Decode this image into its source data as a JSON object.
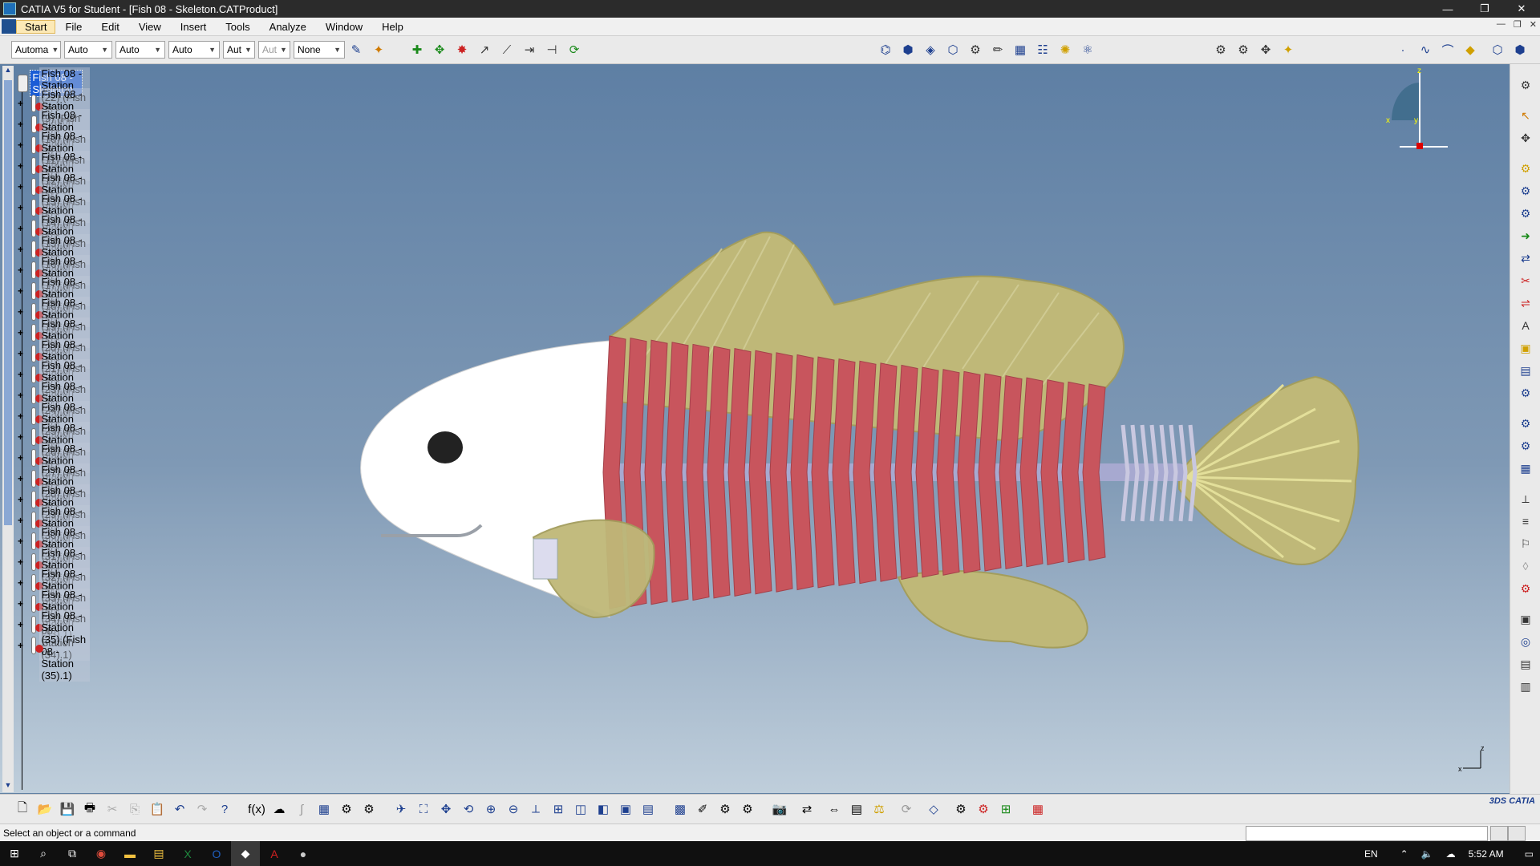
{
  "window": {
    "title": "CATIA V5 for Student - [Fish 08 - Skeleton.CATProduct]",
    "buttons": [
      "—",
      "❐",
      "✕"
    ]
  },
  "menubar": {
    "items": [
      "Start",
      "File",
      "Edit",
      "View",
      "Insert",
      "Tools",
      "Analyze",
      "Window",
      "Help"
    ],
    "doc_buttons": [
      "—",
      "❐",
      "✕"
    ]
  },
  "toolbar_top": {
    "combos": [
      "Automa",
      "Auto",
      "Auto",
      "Auto",
      "Aut",
      "Aut",
      "None"
    ]
  },
  "tree": {
    "root_label": "Fish 08 - Skeleton",
    "rows": [
      "Fish 08 - Station (22) (Fish 08 - Station (22).1)",
      "Fish 08 - Station (9) (Fish 08 - Station (9).1)",
      "Fish 08 - Station (10) (Fish 08 - Station (10).1)",
      "Fish 08 - Station (11) (Fish 08 - Station (11).1)",
      "Fish 08 - Station (12) (Fish 08 - Station (12).1)",
      "Fish 08 - Station (13) (Fish 08 - Station (13).1)",
      "Fish 08 - Station (14) (Fish 08 - Station (14).1)",
      "Fish 08 - Station (15) (Fish 08 - Station (15).1)",
      "Fish 08 - Station (16) (Fish 08 - Station (16).1)",
      "Fish 08 - Station (17) (Fish 08 - Station (17).1)",
      "Fish 08 - Station (18) (Fish 08 - Station (18).1)",
      "Fish 08 - Station (19) (Fish 08 - Station (19).1)",
      "Fish 08 - Station (20) (Fish 08 - Station (20).1)",
      "Fish 08 - Station (21) (Fish 08 - Station (21).1)",
      "Fish 08 - Station (23) (Fish 08 - Station (23).1)",
      "Fish 08 - Station (24) (Fish 08 - Station (24).1)",
      "Fish 08 - Station (25) (Fish 08 - Station (25).1)",
      "Fish 08 - Station (26) (Fish 08 - Station (26).1)",
      "Fish 08 - Station (27) (Fish 08 - Station (27).1)",
      "Fish 08 - Station (28) (Fish 08 - Station (28).1)",
      "Fish 08 - Station (29) (Fish 08 - Station (29).1)",
      "Fish 08 - Station (30) (Fish 08 - Station (30).1)",
      "Fish 08 - Station (31) (Fish 08 - Station (31).1)",
      "Fish 08 - Station (32) (Fish 08 - Station (32).1)",
      "Fish 08 - Station (33) (Fish 08 - Station (33).1)",
      "Fish 08 - Station (34) (Fish 08 - Station (34).1)",
      "Fish 08 - Station (35) (Fish 08 - Station (35).1)"
    ]
  },
  "compass": {
    "x": "x",
    "y": "y",
    "z": "z"
  },
  "status": {
    "message": "Select an object or a command"
  },
  "taskbar": {
    "language": "EN",
    "time": "5:52 AM"
  },
  "colors": {
    "ribs": "#c8555d",
    "fins": "#bfb878",
    "head": "#ffffff",
    "selection": "#1a5cd6"
  }
}
